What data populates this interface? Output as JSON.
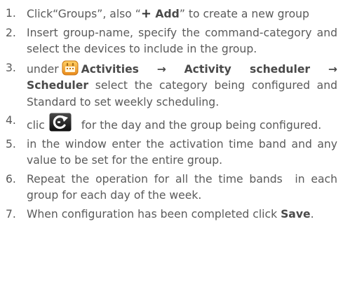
{
  "steps": [
    {
      "num": "1.",
      "parts": {
        "a": "Click“",
        "b": "Groups",
        "c": "”, also “",
        "plus": "+",
        "d": " Add",
        "e": "” to create a new group"
      }
    },
    {
      "num": "2.",
      "text": "Insert group-name, specify the command-category and select the devices to include in the group."
    },
    {
      "num": "3.",
      "parts": {
        "a": "under",
        "b": "Activities",
        "arrow1": "→",
        "c": "Activity scheduler",
        "arrow2": "→",
        "d": "Scheduler",
        "e": " select the category being configured and Standard to set weekly scheduling."
      }
    },
    {
      "num": "4.",
      "parts": {
        "a": "clic",
        "b": "for the day and the group being configured."
      }
    },
    {
      "num": "5.",
      "text": "in the window enter the activation time band and any value to be set for the entire group."
    },
    {
      "num": "6.",
      "text": "Repeat the operation for all the time bands  in each group for each day of the week."
    },
    {
      "num": "7.",
      "parts": {
        "a": "When configuration has been completed click ",
        "b": "Save",
        "c": "."
      }
    }
  ],
  "icons": {
    "activities": "activities-icon",
    "refresh": "refresh-icon"
  },
  "colors": {
    "text": "#5a5a5a",
    "activities_icon": "#f2a52a",
    "refresh_icon": "#1a1a1a"
  }
}
